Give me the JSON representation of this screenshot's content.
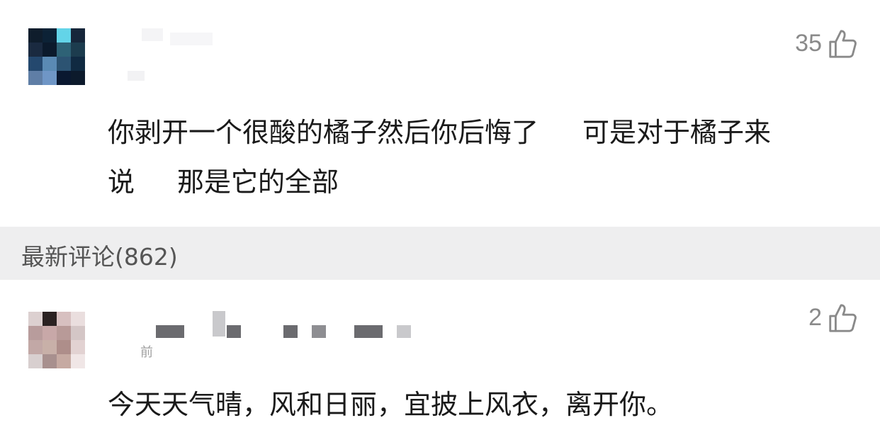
{
  "comments": [
    {
      "likes": "35",
      "text_line1": "你剥开一个很酸的橘子然后你后悔了",
      "text_line1b": "可是对于橘子来",
      "text_line2": "说",
      "text_line2b": "那是它的全部",
      "avatar": [
        "#0f1d2c",
        "#0c2236",
        "#63d4e8",
        "#16263a",
        "#1a2a40",
        "#0b1a2c",
        "#2e6276",
        "#1c3c4e",
        "#24486e",
        "#5a8ab4",
        "#2c5372",
        "#102a42",
        "#5f7ea6",
        "#6f96c6",
        "#0a1830",
        "#0c1a2c"
      ]
    },
    {
      "likes": "2",
      "time": "前",
      "text": "今天天气晴，风和日丽，宜披上风衣，离开你。",
      "avatar": [
        "#dcd0d0",
        "#2b2222",
        "#d7c0c0",
        "#eadede",
        "#b89c9c",
        "#c8a8a8",
        "#b89a98",
        "#d4c6c6",
        "#c2a8a6",
        "#c8b0a8",
        "#ae8e8a",
        "#e2d2d2",
        "#d8cfcf",
        "#a8908e",
        "#c6aaa2",
        "#f0e6e6"
      ]
    }
  ],
  "section": {
    "title": "最新评论(862)"
  },
  "colors": {
    "text": "#1a1a1a",
    "muted": "#8a8a8a",
    "section_bg": "#eeeeef"
  },
  "icons": {
    "like": "thumbs-up-icon"
  }
}
